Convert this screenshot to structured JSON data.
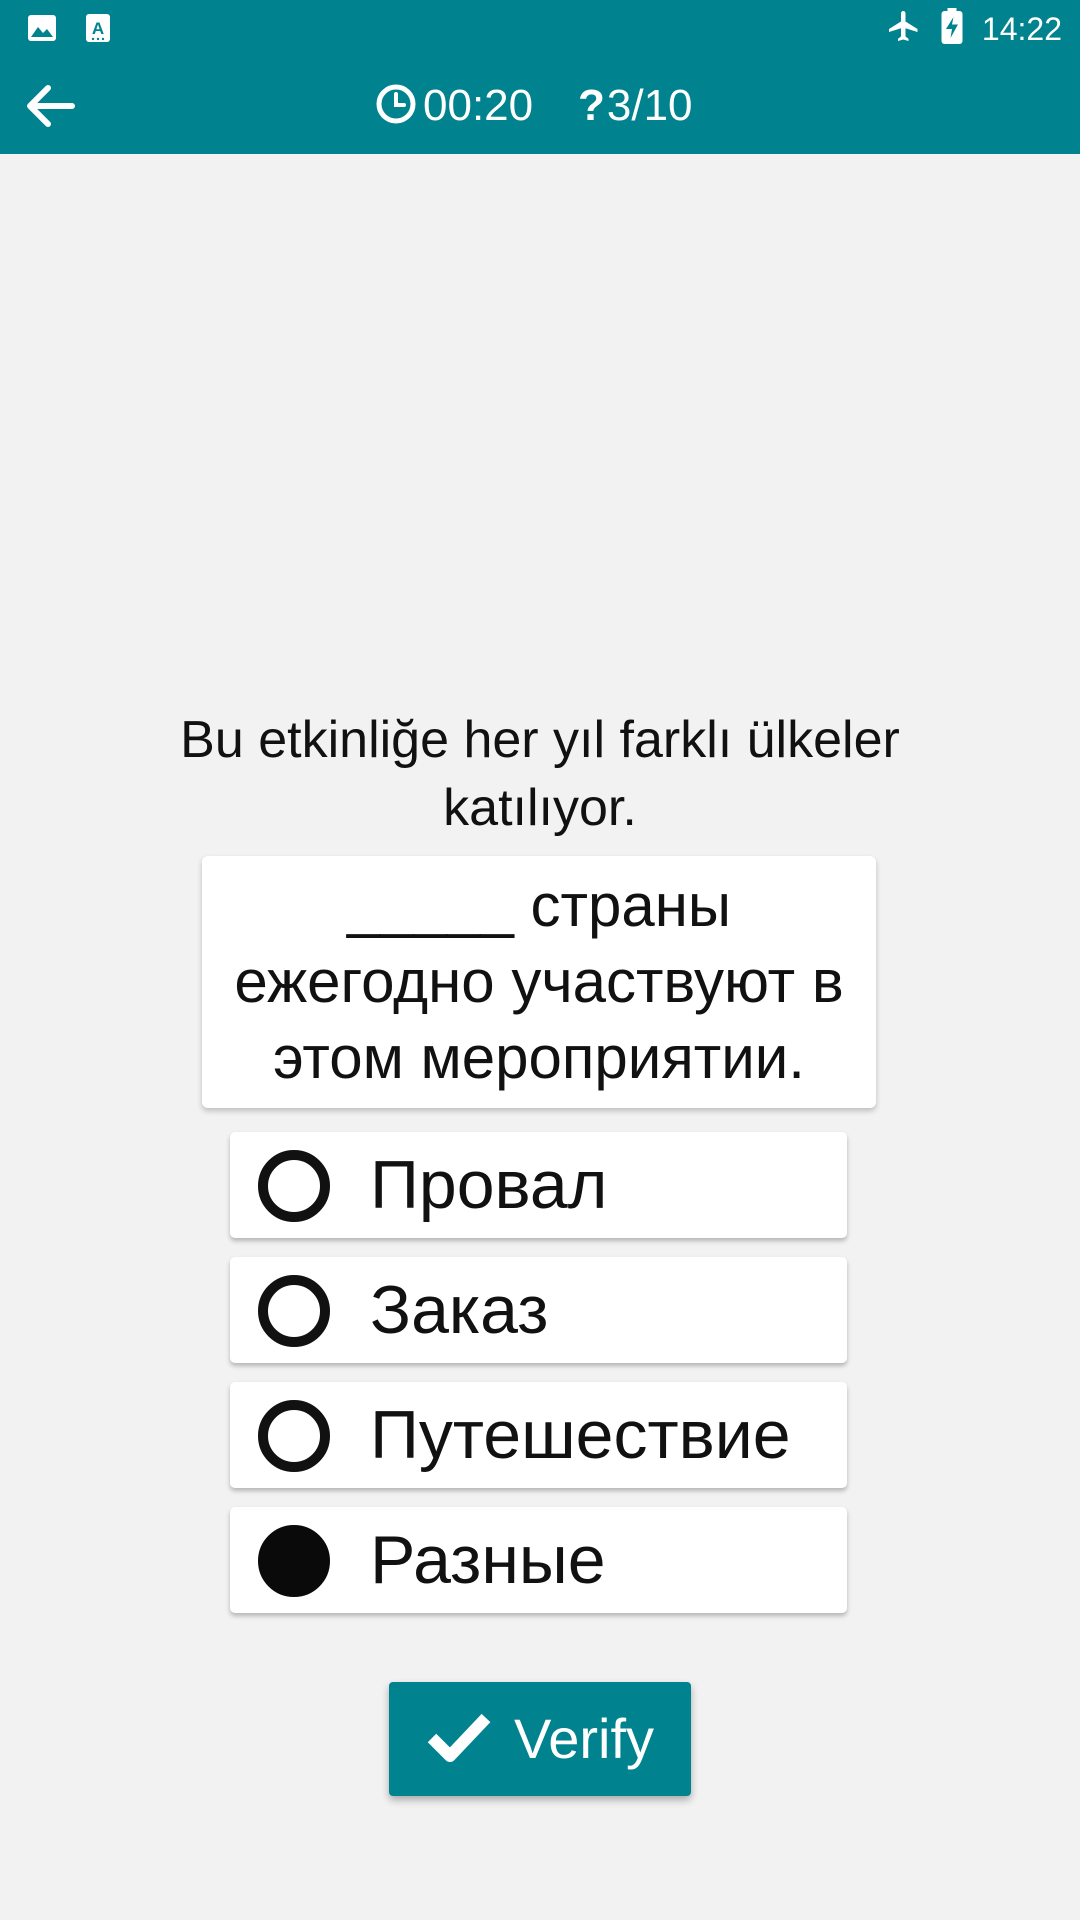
{
  "status_bar": {
    "time": "14:22",
    "left_icons": [
      "image-icon",
      "text-a-icon"
    ],
    "right_icons": [
      "airplane-mode-icon",
      "battery-charging-icon"
    ]
  },
  "app_bar": {
    "back_icon": "arrow-left-icon",
    "timer_icon": "clock-icon",
    "timer": "00:20",
    "question_glyph": "?",
    "question_counter": "3/10"
  },
  "question": {
    "prompt": "Bu etkinliğe her yıl farklı ülkeler katılıyor.",
    "sentence": "_____ страны ежегодно участвуют в этом мероприятии."
  },
  "options": [
    {
      "label": "Провал",
      "selected": false
    },
    {
      "label": "Заказ",
      "selected": false
    },
    {
      "label": "Путешествие",
      "selected": false
    },
    {
      "label": "Разные",
      "selected": true
    }
  ],
  "verify_button": {
    "label": "Verify",
    "icon": "checkmark-icon"
  },
  "colors": {
    "primary": "#00838f",
    "background": "#f2f2f2",
    "card": "#ffffff",
    "text": "#111111"
  }
}
